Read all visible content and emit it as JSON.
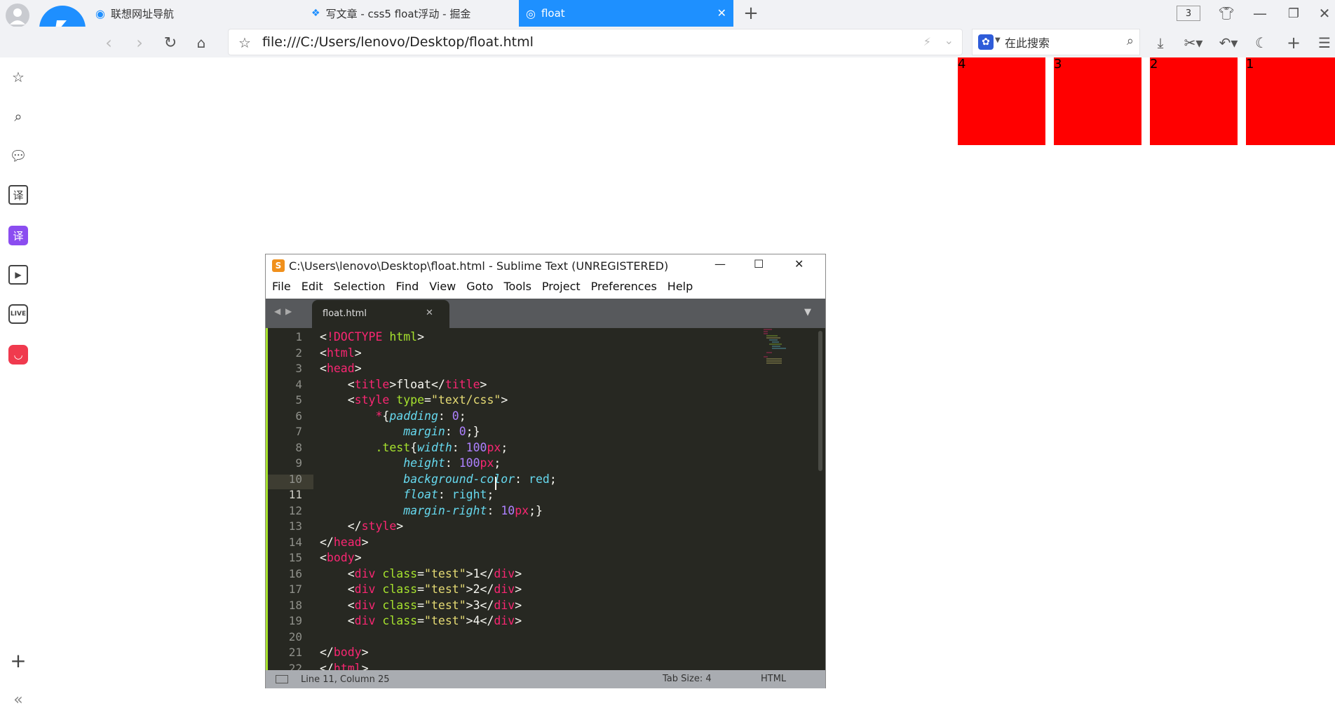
{
  "browser": {
    "tabs": [
      {
        "label": "联想网址导航"
      },
      {
        "label": "写文章 - css5 float浮动 - 掘金"
      },
      {
        "label": "float"
      }
    ],
    "tab_count": "3",
    "url": "file:///C:/Users/lenovo/Desktop/float.html",
    "search_placeholder": "在此搜索",
    "accent": "#1e90ff"
  },
  "page": {
    "boxes": [
      "4",
      "3",
      "2",
      "1"
    ],
    "box_color": "#ff0000"
  },
  "editor": {
    "title": "C:\\Users\\lenovo\\Desktop\\float.html - Sublime Text (UNREGISTERED)",
    "menu": [
      "File",
      "Edit",
      "Selection",
      "Find",
      "View",
      "Goto",
      "Tools",
      "Project",
      "Preferences",
      "Help"
    ],
    "tab_label": "float.html",
    "lines": [
      "<!DOCTYPE html>",
      "<html>",
      "<head>",
      "    <title>float</title>",
      "    <style type=\"text/css\">",
      "        *{padding: 0;",
      "            margin: 0;}",
      "        .test{width: 100px;",
      "            height: 100px;",
      "            background-color: red;",
      "            float: right;",
      "            margin-right: 10px;}",
      "    </style>",
      "</head>",
      "<body>",
      "    <div class=\"test\">1</div>",
      "    <div class=\"test\">2</div>",
      "    <div class=\"test\">3</div>",
      "    <div class=\"test\">4</div>",
      "",
      "</body>",
      "</html>"
    ],
    "status_position": "Line 11, Column 25",
    "status_tabsize": "Tab Size: 4",
    "status_syntax": "HTML"
  }
}
